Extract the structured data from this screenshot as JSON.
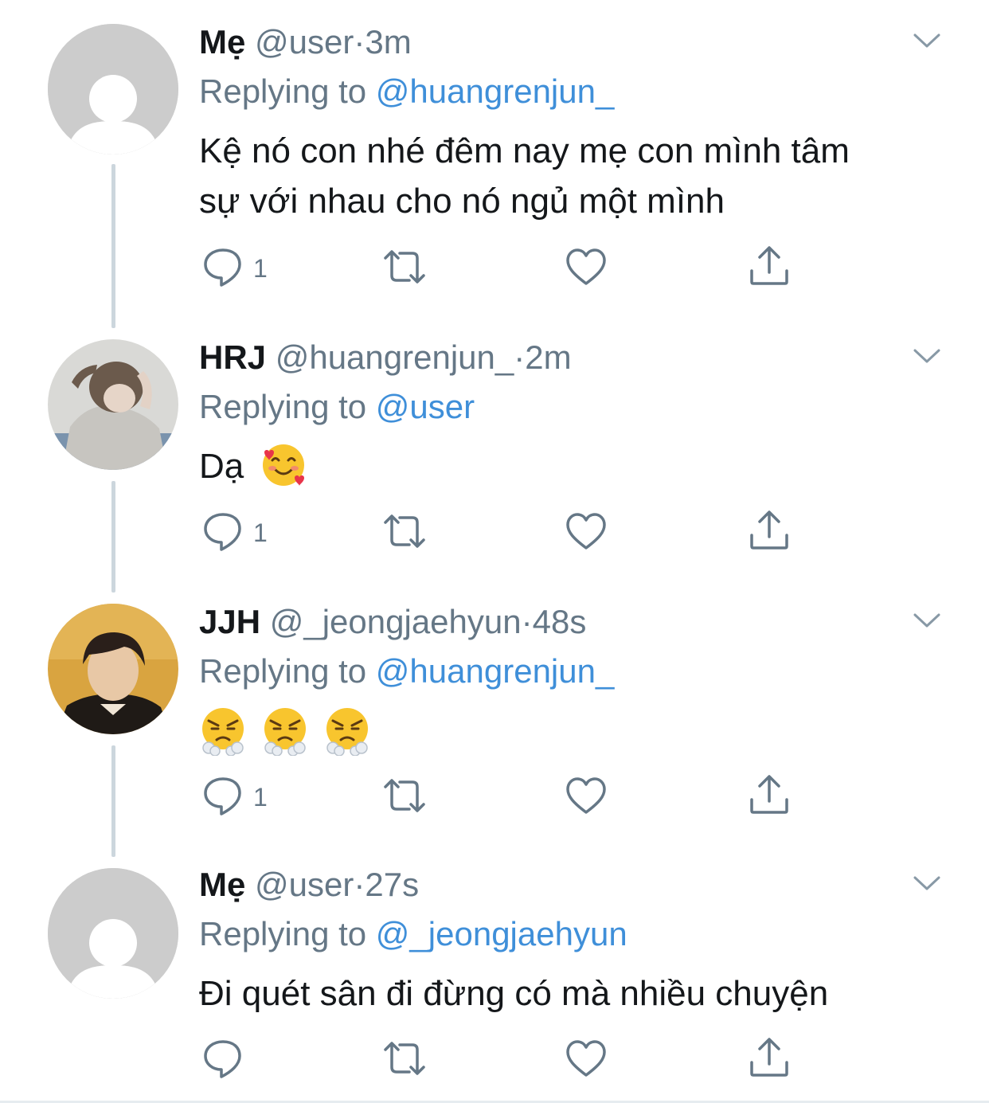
{
  "colors": {
    "text": "#14171a",
    "secondary": "#657786",
    "mention": "#3f8fd9",
    "thread_line": "#ccd6dd",
    "default_avatar_bg": "#cccccc"
  },
  "tweets": [
    {
      "display_name": "Mẹ",
      "handle": "@user",
      "dot": "·",
      "time": "3m",
      "replying_prefix": "Replying to",
      "replying_to": "@huangrenjun_",
      "body_line1": "Kệ nó con nhé đêm nay mẹ con mình tâm",
      "body_line2": "sự với nhau cho nó ngủ một mình",
      "reply_count": "1",
      "avatar_icon": "default-profile-icon"
    },
    {
      "display_name": "HRJ",
      "handle": "@huangrenjun_",
      "dot": "·",
      "time": "2m",
      "replying_prefix": "Replying to",
      "replying_to": "@user",
      "body_text": "Dạ",
      "body_emoji": "smiling-face-with-hearts-emoji",
      "reply_count": "1",
      "avatar_icon": "profile-photo"
    },
    {
      "display_name": "JJH",
      "handle": "@_jeongjaehyun",
      "dot": "·",
      "time": "48s",
      "replying_prefix": "Replying to",
      "replying_to": "@huangrenjun_",
      "body_emoji": "face-with-steam-from-nose-emoji",
      "reply_count": "1",
      "avatar_icon": "profile-photo"
    },
    {
      "display_name": "Mẹ",
      "handle": "@user",
      "dot": "·",
      "time": "27s",
      "replying_prefix": "Replying to",
      "replying_to": "@_jeongjaehyun",
      "body_text": "Đi quét sân đi đừng có mà nhiều chuyện",
      "reply_count": "",
      "avatar_icon": "default-profile-icon"
    }
  ],
  "action_icons": [
    "reply-icon",
    "retweet-icon",
    "like-icon",
    "share-icon"
  ]
}
